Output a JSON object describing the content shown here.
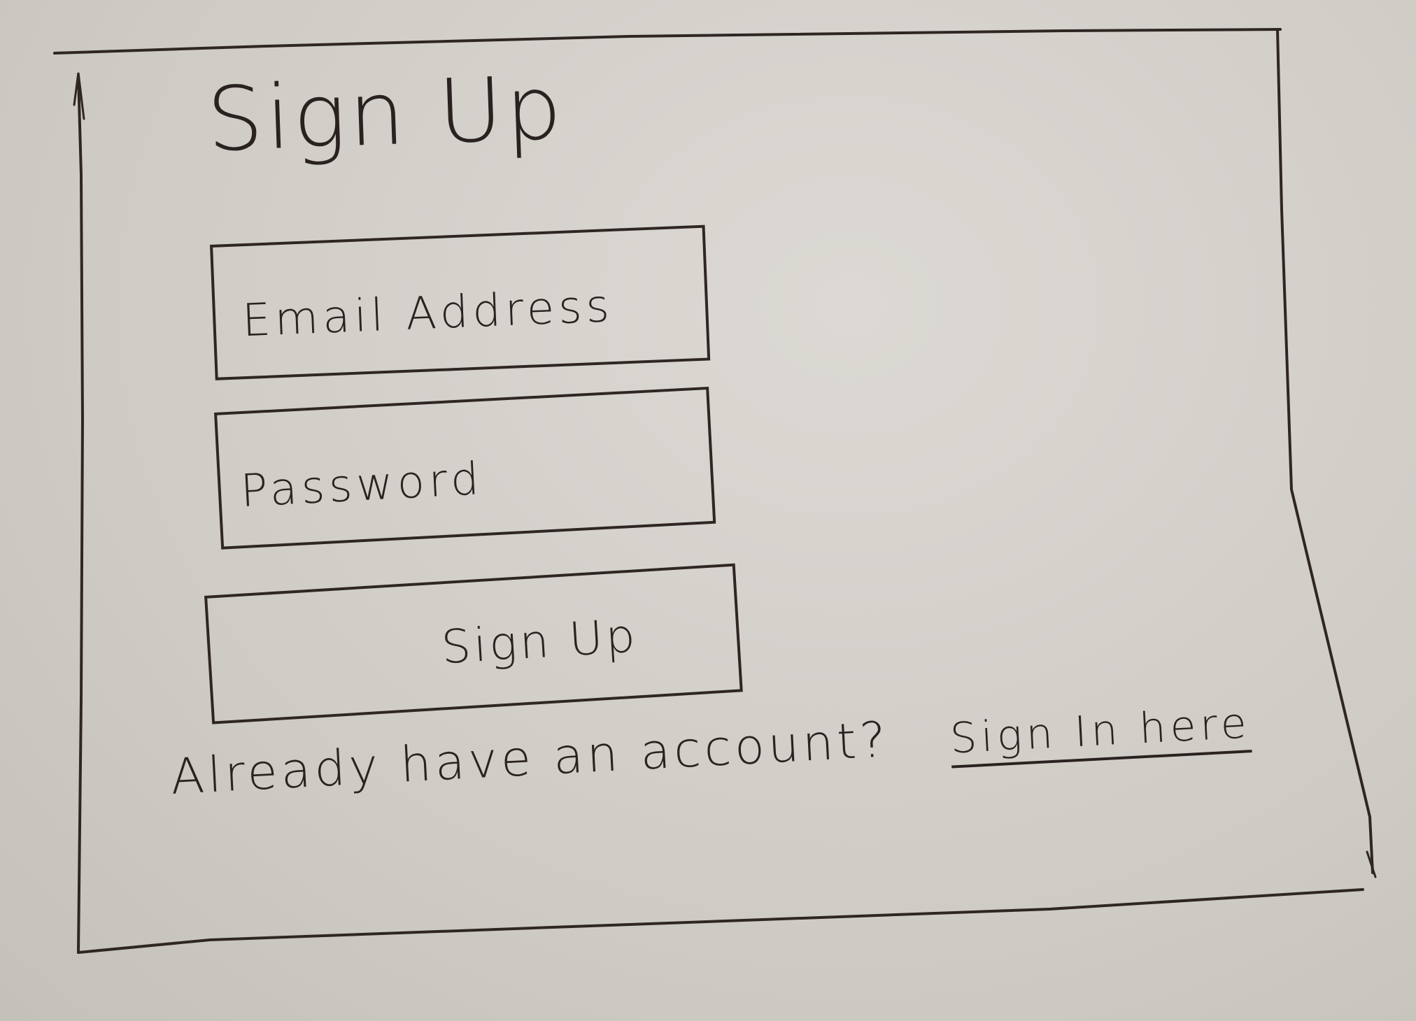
{
  "signup_form": {
    "title": "Sign Up",
    "email_placeholder": "Email Address",
    "password_placeholder": "Password",
    "submit_label": "Sign Up",
    "footer_prompt": "Already have an account?",
    "signin_link": "Sign In here"
  },
  "colors": {
    "ink": "#2a2220",
    "paper": "#d4d0cb"
  }
}
